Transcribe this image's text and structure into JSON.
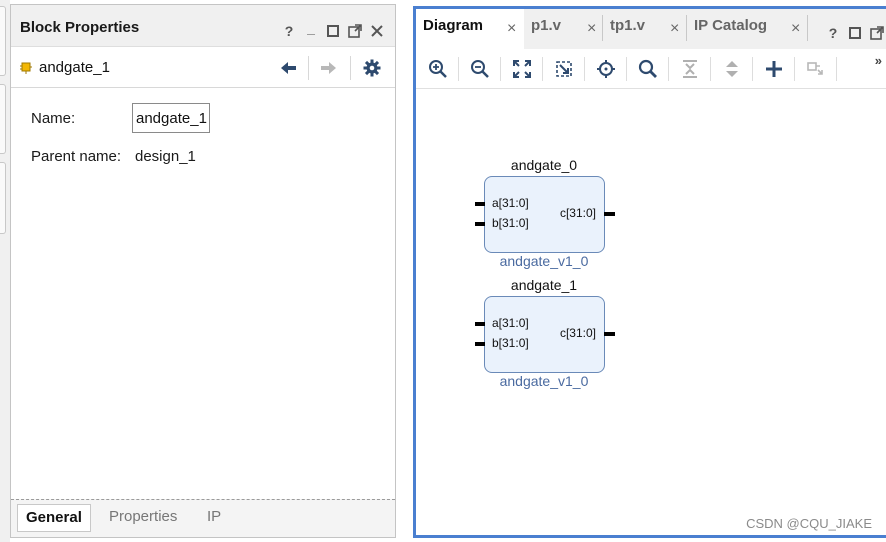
{
  "block_properties": {
    "title": "Block Properties",
    "window_controls": {
      "help": "?",
      "minimize": "_"
    },
    "object_name": "andgate_1",
    "fields": {
      "name_label": "Name:",
      "name_value": "andgate_1",
      "parent_label": "Parent name:",
      "parent_value": "design_1"
    },
    "tabs": [
      "General",
      "Properties",
      "IP"
    ]
  },
  "diagram": {
    "tabs": [
      {
        "label": "Diagram",
        "close": "×"
      },
      {
        "label": "p1.v",
        "close": "×"
      },
      {
        "label": "tp1.v",
        "close": "×"
      },
      {
        "label": "IP Catalog",
        "close": "×"
      }
    ],
    "window_controls": {
      "help": "?"
    },
    "overflow": "»",
    "blocks": [
      {
        "instance": "andgate_0",
        "ports_in": [
          "a[31:0]",
          "b[31:0]"
        ],
        "port_out": "c[31:0]",
        "type": "andgate_v1_0"
      },
      {
        "instance": "andgate_1",
        "ports_in": [
          "a[31:0]",
          "b[31:0]"
        ],
        "port_out": "c[31:0]",
        "type": "andgate_v1_0"
      }
    ],
    "watermark": "CSDN @CQU_JIAKE"
  },
  "colors": {
    "accent_border": "#4a7fd0",
    "block_fill": "#eaf2fc",
    "block_stroke": "#6a8ab8",
    "toolbar_icon": "#2e4a6e"
  }
}
